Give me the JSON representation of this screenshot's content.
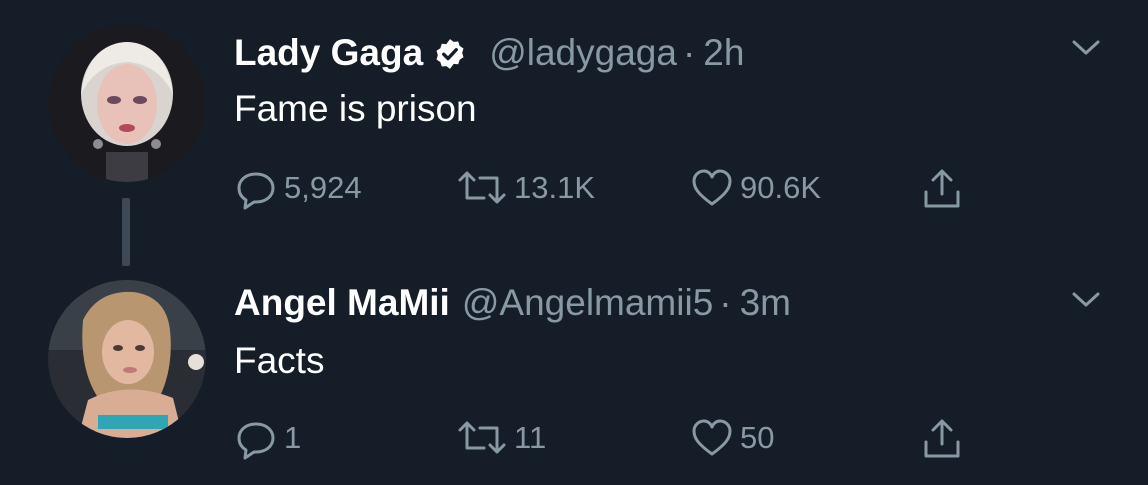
{
  "tweets": [
    {
      "name": "Lady Gaga",
      "verified": true,
      "handle": "@ladygaga",
      "separator": "·",
      "time": "2h",
      "text": "Fame is prison",
      "replies": "5,924",
      "retweets": "13.1K",
      "likes": "90.6K"
    },
    {
      "name": "Angel MaMii",
      "verified": false,
      "handle": "@Angelmamii5",
      "separator": "·",
      "time": "3m",
      "text": "Facts",
      "replies": "1",
      "retweets": "11",
      "likes": "50"
    }
  ],
  "colors": {
    "background": "#151d28",
    "text_primary": "#ffffff",
    "text_secondary": "#8899a6",
    "thread_line": "#3d4957"
  },
  "icons": [
    "verified-badge-icon",
    "chevron-down-icon",
    "reply-icon",
    "retweet-icon",
    "like-icon",
    "share-icon"
  ]
}
